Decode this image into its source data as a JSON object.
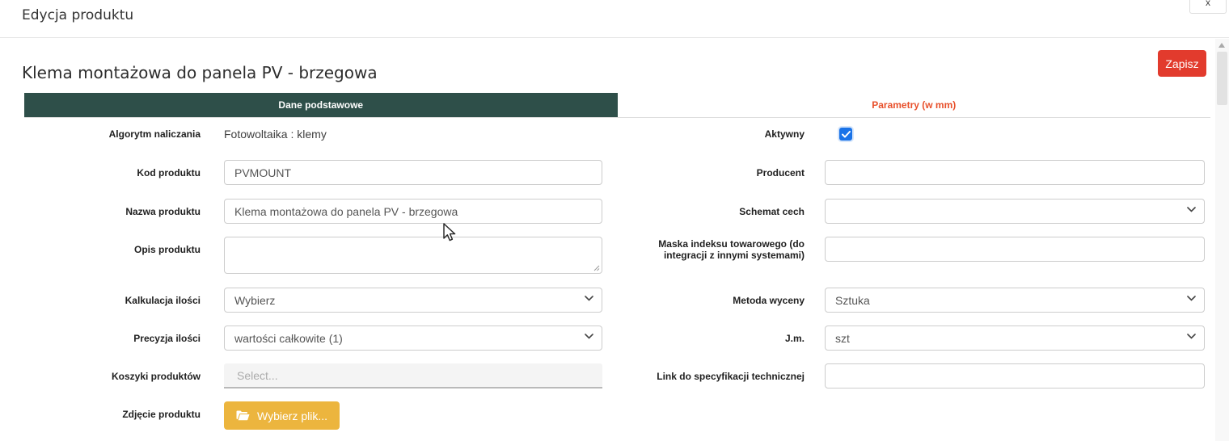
{
  "modal": {
    "title": "Edycja produktu",
    "close_label": "x"
  },
  "toolbar": {
    "save_label": "Zapisz"
  },
  "product": {
    "heading": "Klema montażowa do panela PV - brzegowa"
  },
  "tabs": {
    "basic": {
      "label": "Dane podstawowe",
      "active": true
    },
    "params": {
      "label": "Parametry (w mm)",
      "active": false
    }
  },
  "form": {
    "left": {
      "algorytm": {
        "label": "Algorytm naliczania",
        "value": "Fotowoltaika : klemy"
      },
      "kod": {
        "label": "Kod produktu",
        "value": "PVMOUNT"
      },
      "nazwa": {
        "label": "Nazwa produktu",
        "value": "Klema montażowa do panela PV - brzegowa"
      },
      "opis": {
        "label": "Opis produktu",
        "value": ""
      },
      "kalkulacja": {
        "label": "Kalkulacja ilości",
        "value": "Wybierz"
      },
      "precyzja": {
        "label": "Precyzja ilości",
        "value": "wartości całkowite (1)"
      },
      "koszyki": {
        "label": "Koszyki produktów",
        "placeholder": "Select..."
      },
      "zdjecie": {
        "label": "Zdjęcie produktu",
        "button_label": "Wybierz plik..."
      }
    },
    "right": {
      "aktywny": {
        "label": "Aktywny",
        "checked": true
      },
      "producent": {
        "label": "Producent",
        "value": ""
      },
      "schemat": {
        "label": "Schemat cech",
        "value": ""
      },
      "maska": {
        "label": "Maska indeksu towarowego (do integracji z innymi systemami)",
        "value": ""
      },
      "metoda": {
        "label": "Metoda wyceny",
        "value": "Sztuka"
      },
      "jm": {
        "label": "J.m.",
        "value": "szt"
      },
      "link": {
        "label": "Link do specyfikacji technicznej",
        "value": ""
      }
    }
  },
  "icons": {
    "close": "close-icon",
    "chevron_down": "chevron-down-icon",
    "checkmark": "checkmark-icon",
    "folder_open": "folder-open-icon",
    "resize_grip": "resize-grip-icon",
    "scroll_up_arrow": "scroll-up-arrow-icon",
    "mouse_cursor": "arrow-cursor-icon"
  },
  "colors": {
    "save_button": "#e23b2d",
    "tab_active_bg": "#2e4f49",
    "tab_inactive_text": "#e8502b",
    "checkbox_accent": "#1a73e8",
    "file_button": "#ecb53e"
  }
}
